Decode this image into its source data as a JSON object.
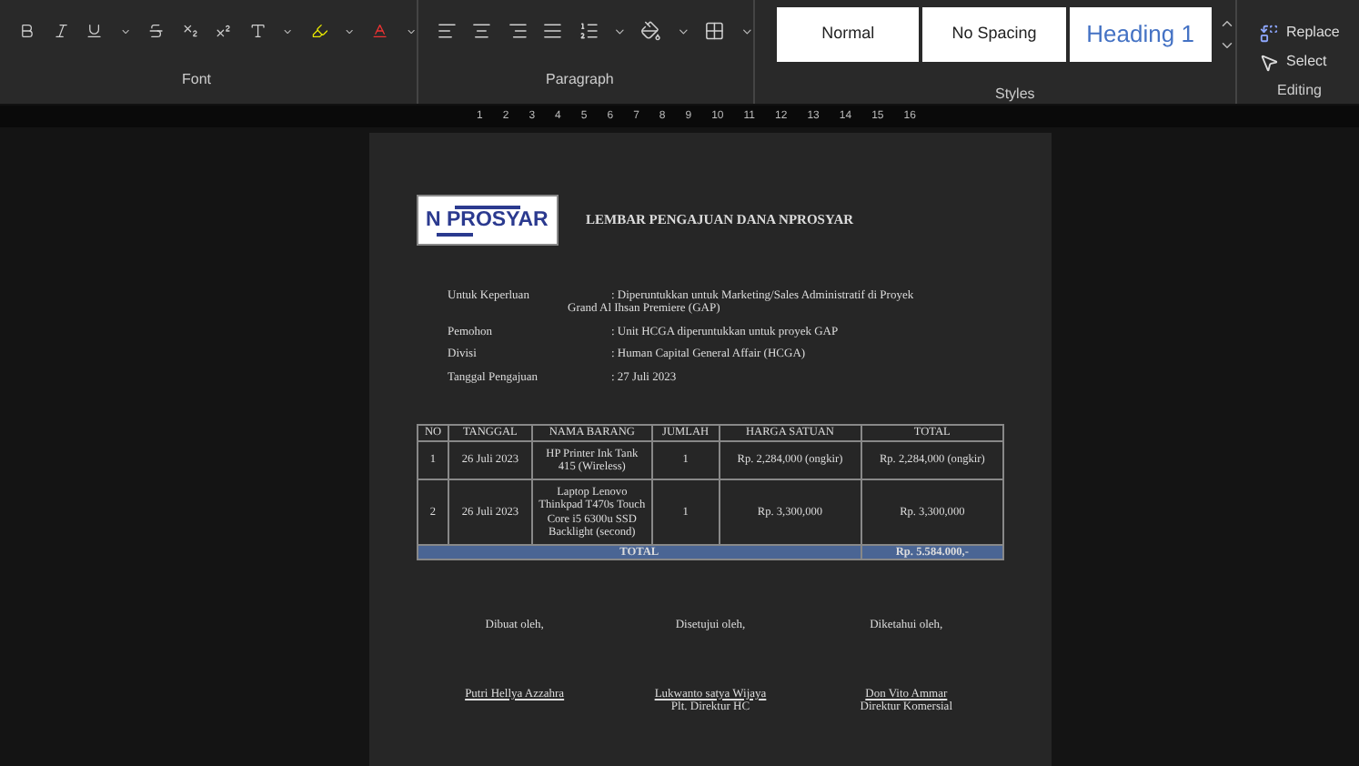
{
  "ribbon": {
    "font_label": "Font",
    "paragraph_label": "Paragraph",
    "styles": [
      {
        "label": "Normal",
        "kind": "normal"
      },
      {
        "label": "No Spacing",
        "kind": "normal"
      },
      {
        "label": "Heading 1",
        "kind": "heading"
      }
    ],
    "styles_label": "Styles",
    "editing": [
      "Replace",
      "Select"
    ],
    "editing_label": "Editing"
  },
  "ruler": {
    "numbers": [
      "1",
      "2",
      "3",
      "4",
      "5",
      "6",
      "7",
      "8",
      "9",
      "10",
      "11",
      "12",
      "13",
      "14",
      "15",
      "16"
    ]
  },
  "document": {
    "logo": "N PROSYAR",
    "title": "LEMBAR PENGAJUAN DANA NPROSYAR",
    "fields": [
      {
        "label": "Untuk Keperluan",
        "value": ": Diperuntukkan untuk Marketing/Sales Administratif di Proyek",
        "continuation": "Grand Al Ihsan Premiere (GAP)"
      },
      {
        "label": "Pemohon",
        "value": ": Unit HCGA diperuntukkan untuk proyek GAP"
      },
      {
        "label": "Divisi",
        "value": ": Human Capital General Affair (HCGA)"
      },
      {
        "label": "Tanggal Pengajuan",
        "value": ": 27 Juli 2023"
      }
    ],
    "table": {
      "columns": [
        "NO",
        "TANGGAL",
        "NAMA BARANG",
        "JUMLAH",
        "HARGA SATUAN",
        "TOTAL"
      ],
      "rows": [
        [
          "1",
          "26 Juli 2023",
          "HP Printer Ink Tank 415 (Wireless)",
          "1",
          "Rp. 2,284,000 (ongkir)",
          "Rp. 2,284,000 (ongkir)"
        ],
        [
          "2",
          "26 Juli 2023",
          "Laptop Lenovo Thinkpad T470s Touch Core i5 6300u SSD Backlight (second)",
          "1",
          "Rp. 3,300,000",
          "Rp. 3,300,000"
        ]
      ],
      "total_label": "TOTAL",
      "total_value": "Rp. 5.584.000,-"
    },
    "signatures": [
      {
        "role": "Dibuat oleh,",
        "name": "Putri Hellya Azzahra"
      },
      {
        "role": "Disetujui oleh,",
        "name": "Lukwanto satya Wijaya",
        "title": "Plt. Direktur HC"
      },
      {
        "role": "Diketahui oleh,",
        "name": "Don Vito Ammar",
        "title": "Direktur Komersial"
      }
    ]
  }
}
